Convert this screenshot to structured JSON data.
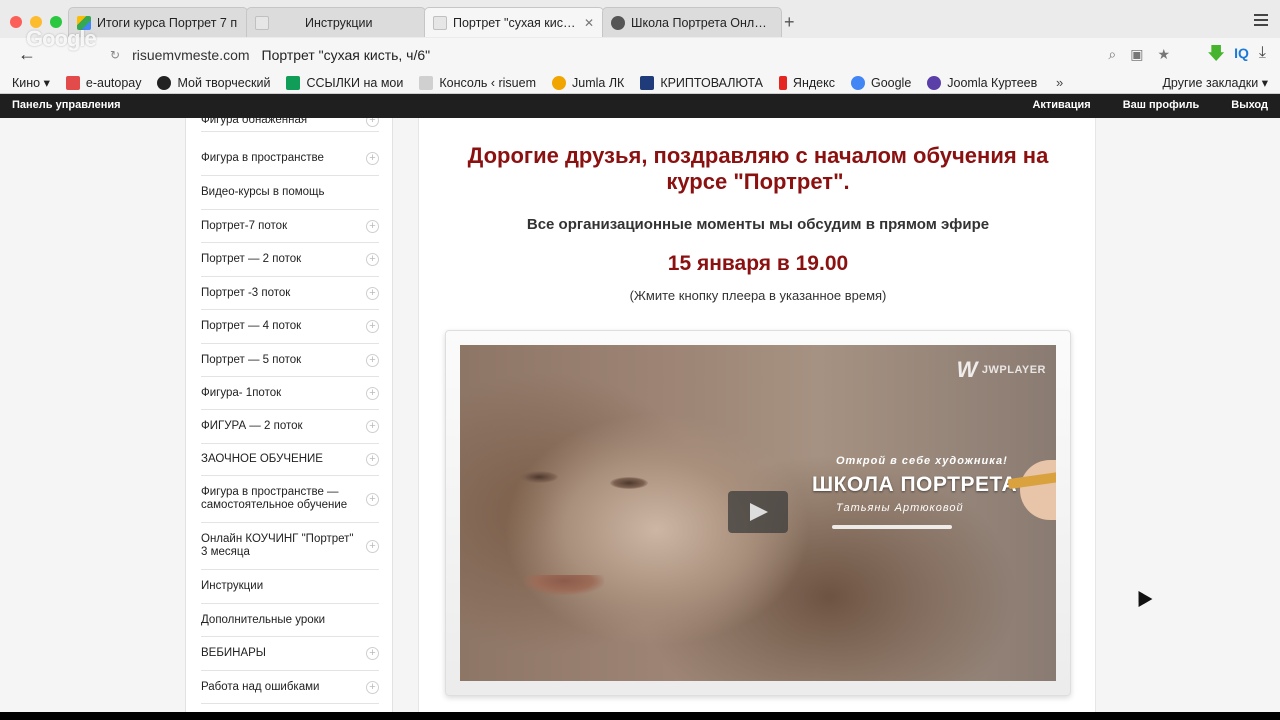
{
  "browser": {
    "tabs": [
      {
        "title": "Итоги курса Портрет 7 п",
        "favicon_color": "#3b82f6",
        "active": false
      },
      {
        "title": "Инструкции",
        "favicon_color": "#e0e0e0",
        "active": false
      },
      {
        "title": "Портрет \"сухая кисть, ч",
        "favicon_color": "#e0e0e0",
        "active": true
      },
      {
        "title": "Школа Портрета Онлайн",
        "favicon_color": "#555555",
        "active": false
      }
    ],
    "close_glyph": "✕",
    "new_tab_glyph": "+",
    "url_host": "risuemvmeste.com",
    "url_title": "Портрет \"сухая кисть, ч/6\"",
    "watermark": "Google"
  },
  "bookmarks": [
    {
      "label": "Кино ▾",
      "icon_color": ""
    },
    {
      "label": "e-autopay",
      "icon_color": "#e34b4b"
    },
    {
      "label": "Мой творческий",
      "icon_color": "#222222"
    },
    {
      "label": "ССЫЛКИ на мои",
      "icon_color": "#0f9d58"
    },
    {
      "label": "Консоль ‹ risuem",
      "icon_color": "#d0d0d0"
    },
    {
      "label": "Jumla ЛК",
      "icon_color": "#f0a500"
    },
    {
      "label": "КРИПТОВАЛЮТА",
      "icon_color": "#1f3b7a"
    },
    {
      "label": "Яндекс",
      "icon_color": "#e52620"
    },
    {
      "label": "Google",
      "icon_color": "#4285f4"
    },
    {
      "label": "Joomla Куртеев",
      "icon_color": "#5b3fa8"
    }
  ],
  "bookmarks_more": "»",
  "bookmarks_other": "Другие закладки ▾",
  "adminbar": {
    "left": "Панель управления",
    "right": [
      "Активация",
      "Ваш профиль",
      "Выход"
    ]
  },
  "sidebar": {
    "items": [
      {
        "label": "Фигура обнаженная",
        "plus": true
      },
      {
        "label": "Фигура в пространстве",
        "plus": true
      },
      {
        "label": "Видео-курсы в помощь",
        "plus": false
      },
      {
        "label": "Портрет-7 поток",
        "plus": true
      },
      {
        "label": "Портрет — 2 поток",
        "plus": true
      },
      {
        "label": "Портрет -3 поток",
        "plus": true
      },
      {
        "label": "Портрет — 4 поток",
        "plus": true
      },
      {
        "label": "Портрет — 5 поток",
        "plus": true
      },
      {
        "label": "Фигура- 1поток",
        "plus": true
      },
      {
        "label": "ФИГУРА — 2 поток",
        "plus": true
      },
      {
        "label": "ЗАОЧНОЕ ОБУЧЕНИЕ",
        "plus": true
      },
      {
        "label": "Фигура в пространстве — самостоятельное обучение",
        "plus": true
      },
      {
        "label": "Онлайн КОУЧИНГ \"Портрет\" 3 месяца",
        "plus": true
      },
      {
        "label": "Инструкции",
        "plus": false
      },
      {
        "label": "Дополнительные уроки",
        "plus": false
      },
      {
        "label": "ВЕБИНАРЫ",
        "plus": true
      },
      {
        "label": "Работа над ошибками",
        "plus": true
      }
    ],
    "plus_glyph": "+"
  },
  "main": {
    "headline": "Дорогие друзья, поздравляю с началом обучения на курсе \"Портрет\".",
    "subline": "Все организационные моменты мы  обсудим в прямом эфире",
    "date": "15 января в 19.00",
    "note": "(Жмите кнопку плеера в указанное время)"
  },
  "player": {
    "brand": "JWPLAYER",
    "brand_mark": "W",
    "promo_tag": "Открой в себе художника!",
    "promo_title": "ШКОЛА ПОРТРЕТА",
    "promo_sub": "Татьяны Артюковой"
  },
  "colors": {
    "accent": "#8b1111",
    "adminbar": "#1f1f1f"
  }
}
